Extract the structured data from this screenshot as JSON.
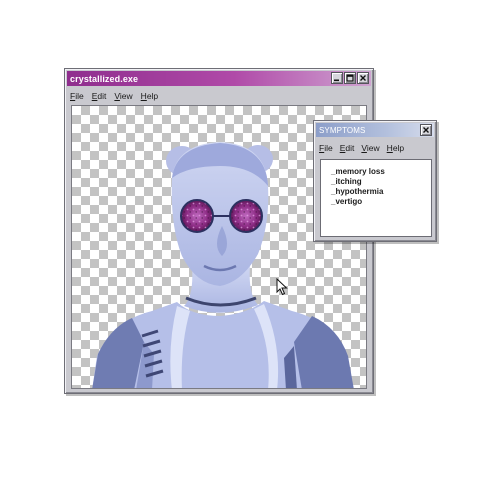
{
  "main_window": {
    "title": "crystallized.exe",
    "menu": [
      "File",
      "Edit",
      "View",
      "Help"
    ]
  },
  "symptoms_window": {
    "title": "SYMPTOMS",
    "menu": [
      "File",
      "Edit",
      "View",
      "Help"
    ],
    "items": [
      "_memory loss",
      "_itching",
      "_hypothermia",
      "_vertigo"
    ]
  },
  "colors": {
    "main_titlebar": "#9b3a98",
    "symptoms_titlebar": "#9aa9d1",
    "window_face": "#c9c9cf",
    "photo_tint": "#b9c4ea",
    "lens": "#8d2c85"
  },
  "icons": [
    "minimize-icon",
    "maximize-icon",
    "close-icon",
    "mouse-pointer-icon"
  ]
}
